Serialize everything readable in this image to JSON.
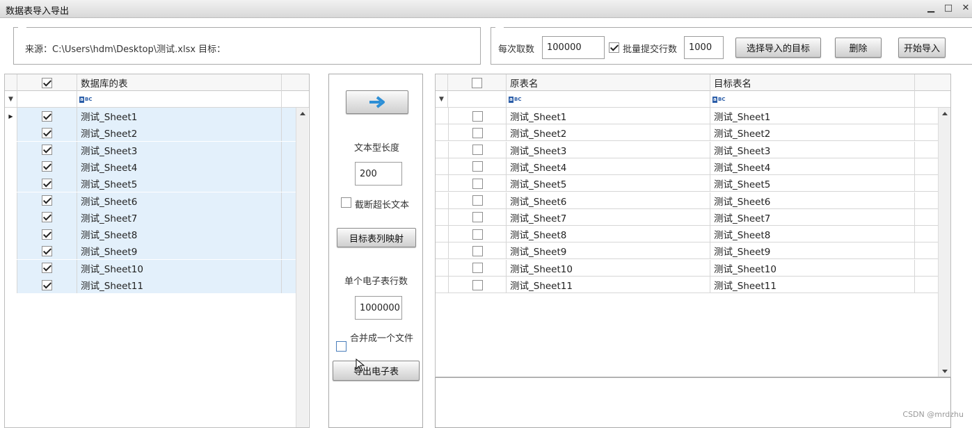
{
  "window": {
    "title": "数据表导入导出",
    "minimize_glyph": "▁",
    "maximize_glyph": "□",
    "close_glyph": "✕"
  },
  "source_box": {
    "text": "来源：C:\\Users\\hdm\\Desktop\\测试.xlsx  目标："
  },
  "options": {
    "per_fetch_label": "每次取数",
    "per_fetch_value": "100000",
    "batch_commit_label": "批量提交行数",
    "batch_commit_checked": true,
    "batch_commit_value": "1000",
    "select_target_button": "选择导入的目标",
    "delete_button": "删除",
    "start_import_button": "开始导入"
  },
  "left_grid": {
    "header_checked": true,
    "column_header": "数据库的表",
    "filter_icon": "filter-icon",
    "rows": [
      {
        "name": "测试_Sheet1",
        "checked": true
      },
      {
        "name": "测试_Sheet2",
        "checked": true
      },
      {
        "name": "测试_Sheet3",
        "checked": true
      },
      {
        "name": "测试_Sheet4",
        "checked": true
      },
      {
        "name": "测试_Sheet5",
        "checked": true
      },
      {
        "name": "测试_Sheet6",
        "checked": true
      },
      {
        "name": "测试_Sheet7",
        "checked": true
      },
      {
        "name": "测试_Sheet8",
        "checked": true
      },
      {
        "name": "测试_Sheet9",
        "checked": true
      },
      {
        "name": "测试_Sheet10",
        "checked": true
      },
      {
        "name": "测试_Sheet11",
        "checked": true
      }
    ]
  },
  "middle_panel": {
    "arrow_icon": "arrow-right-icon",
    "text_length_label": "文本型长度",
    "text_length_value": "200",
    "truncate_label": "截断超长文本",
    "truncate_checked": false,
    "column_mapping_button": "目标表列映射",
    "rows_per_sheet_label": "单个电子表行数",
    "rows_per_sheet_value": "1000000",
    "merge_label": "合并成一个文件",
    "merge_checked": false,
    "export_button": "导出电子表"
  },
  "right_grid": {
    "header_checked": false,
    "col_source": "原表名",
    "col_target": "目标表名",
    "rows": [
      {
        "source": "测试_Sheet1",
        "target": "测试_Sheet1"
      },
      {
        "source": "测试_Sheet2",
        "target": "测试_Sheet2"
      },
      {
        "source": "测试_Sheet3",
        "target": "测试_Sheet3"
      },
      {
        "source": "测试_Sheet4",
        "target": "测试_Sheet4"
      },
      {
        "source": "测试_Sheet5",
        "target": "测试_Sheet5"
      },
      {
        "source": "测试_Sheet6",
        "target": "测试_Sheet6"
      },
      {
        "source": "测试_Sheet7",
        "target": "测试_Sheet7"
      },
      {
        "source": "测试_Sheet8",
        "target": "测试_Sheet8"
      },
      {
        "source": "测试_Sheet9",
        "target": "测试_Sheet9"
      },
      {
        "source": "测试_Sheet10",
        "target": "测试_Sheet10"
      },
      {
        "source": "测试_Sheet11",
        "target": "测试_Sheet11"
      }
    ]
  },
  "watermark": "CSDN @mrdzhu"
}
